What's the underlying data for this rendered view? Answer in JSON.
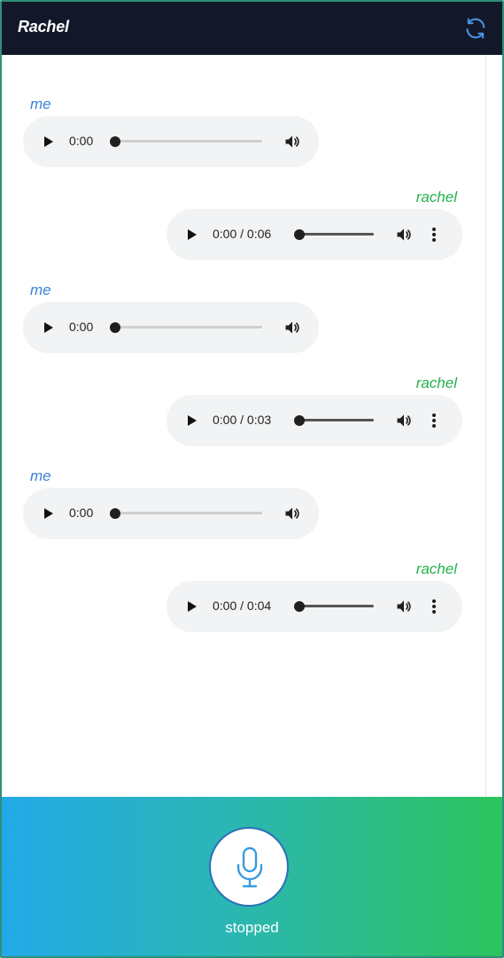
{
  "header": {
    "title": "Rachel",
    "refresh_icon": "refresh-icon"
  },
  "messages": [
    {
      "sender": "me",
      "time_label": "0:00",
      "has_duration": false,
      "progress": 0
    },
    {
      "sender": "rachel",
      "time_label": "0:00 / 0:06",
      "has_duration": true,
      "progress": 0
    },
    {
      "sender": "me",
      "time_label": "0:00",
      "has_duration": false,
      "progress": 0
    },
    {
      "sender": "rachel",
      "time_label": "0:00 / 0:03",
      "has_duration": true,
      "progress": 0
    },
    {
      "sender": "me",
      "time_label": "0:00",
      "has_duration": false,
      "progress": 0
    },
    {
      "sender": "rachel",
      "time_label": "0:00 / 0:04",
      "has_duration": true,
      "progress": 0
    }
  ],
  "footer": {
    "mic_icon": "microphone-icon",
    "status": "stopped"
  },
  "colors": {
    "header_bg": "#121829",
    "me": "#3b82d6",
    "rachel": "#22b14c",
    "footer_start": "#23a9e8",
    "footer_end": "#2cc45e"
  }
}
